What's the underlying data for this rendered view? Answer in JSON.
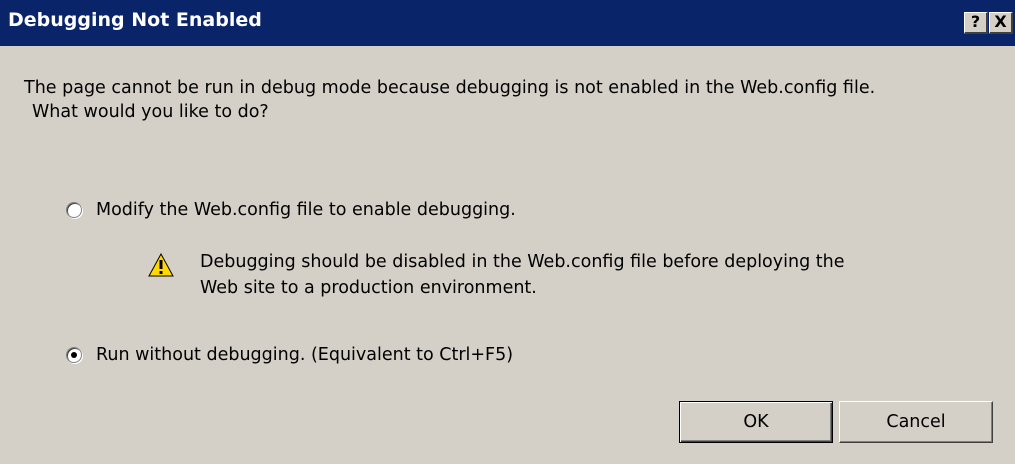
{
  "window": {
    "title": "Debugging Not Enabled",
    "help_label": "?",
    "close_label": "X"
  },
  "message": {
    "line1": "The page cannot be run in debug mode because debugging is not enabled in the Web.config file.",
    "line2": "What would you like to do?"
  },
  "options": [
    {
      "label": "Modify the Web.config file to enable debugging.",
      "selected": false
    },
    {
      "label": "Run without debugging. (Equivalent to Ctrl+F5)",
      "selected": true
    }
  ],
  "warning": {
    "icon": "warning-icon",
    "line1": "Debugging should be disabled in the Web.config file before deploying the",
    "line2": "Web site to a production environment."
  },
  "buttons": {
    "ok_label": "OK",
    "cancel_label": "Cancel"
  },
  "colors": {
    "titlebar": "#0a246a",
    "dialog_bg": "#d4d0c8",
    "warning_fill": "#ffd800"
  }
}
